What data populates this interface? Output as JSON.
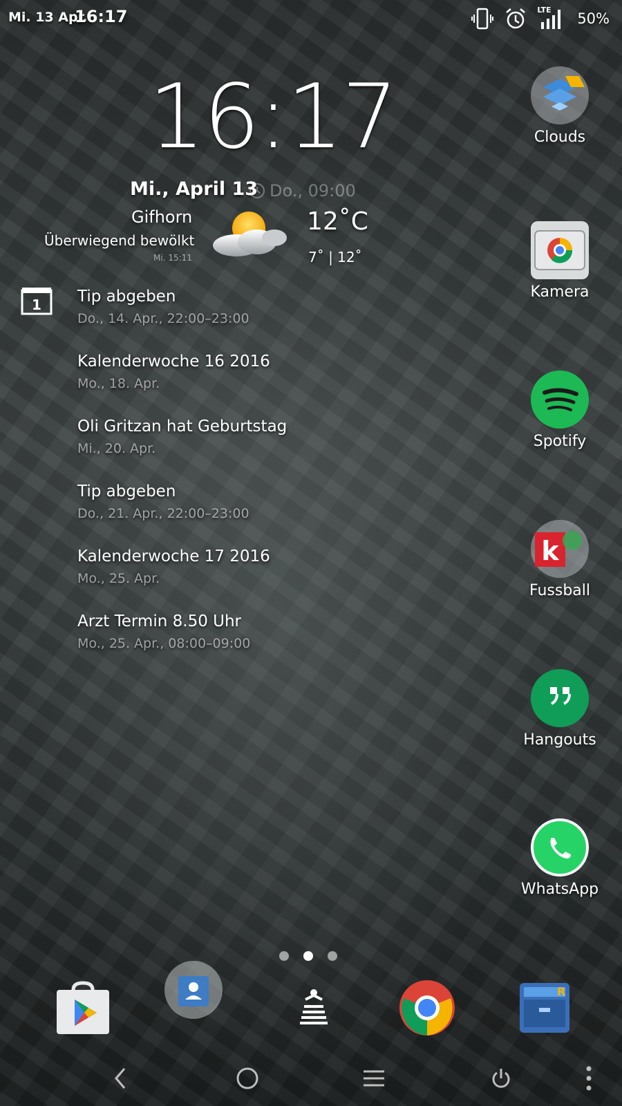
{
  "status_bar": {
    "date": "Mi. 13 Apr.",
    "time": "16:17",
    "network": "LTE",
    "battery": "50%"
  },
  "clock": {
    "time": "16:17",
    "date": "Mi., April 13",
    "next_alarm": "Do., 09:00"
  },
  "weather": {
    "city": "Gifhorn",
    "condition": "Überwiegend bewölkt",
    "updated": "Mi. 15:11",
    "temperature": "12˚C",
    "range": "7˚ | 12˚"
  },
  "agenda": {
    "calendar_day": "1",
    "events": [
      {
        "title": "Tip abgeben",
        "when": "Do., 14. Apr., 22:00–23:00"
      },
      {
        "title": "Kalenderwoche 16 2016",
        "when": "Mo., 18. Apr."
      },
      {
        "title": "Oli Gritzan hat Geburtstag",
        "when": "Mi., 20. Apr."
      },
      {
        "title": "Tip abgeben",
        "when": "Do., 21. Apr., 22:00–23:00"
      },
      {
        "title": "Kalenderwoche 17 2016",
        "when": "Mo., 25. Apr."
      },
      {
        "title": "Arzt Termin 8.50 Uhr",
        "when": "Mo., 25. Apr., 08:00–09:00"
      }
    ]
  },
  "apps": {
    "clouds": "Clouds",
    "kamera": "Kamera",
    "spotify": "Spotify",
    "fussball": "Fussball",
    "hangouts": "Hangouts",
    "whatsapp": "WhatsApp"
  },
  "pager": {
    "pages": 3,
    "current": 2
  },
  "colors": {
    "spotify": "#1db954",
    "hangouts": "#0f9d58",
    "whatsapp": "#25d366",
    "chrome_red": "#db4437",
    "chrome_yellow": "#f4b400",
    "chrome_green": "#0f9d58",
    "chrome_blue": "#4285f4",
    "kicker_red": "#d9232e"
  }
}
